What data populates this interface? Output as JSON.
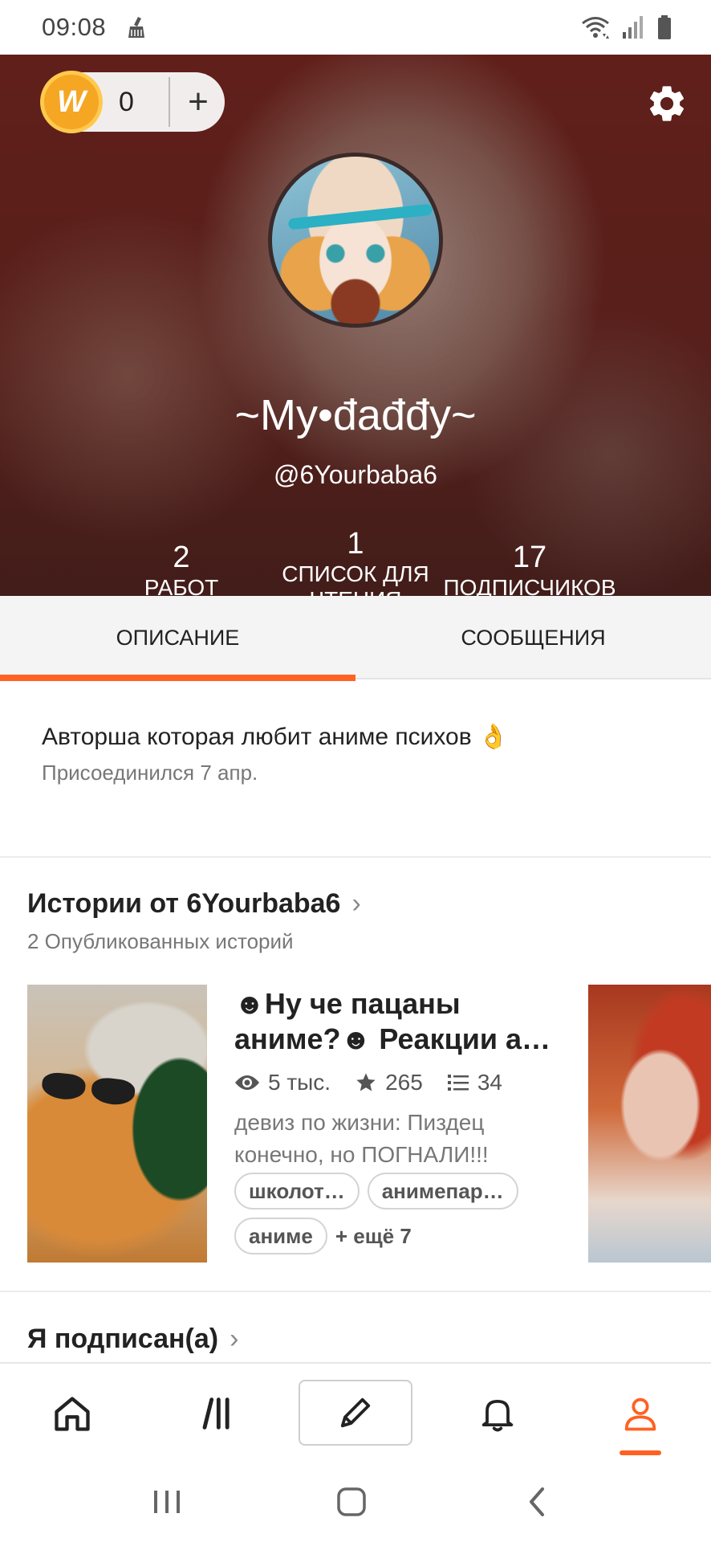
{
  "status_bar": {
    "time": "09:08",
    "left_icon": "cleaner-icon",
    "right_icons": [
      "wifi-icon",
      "signal-icon",
      "battery-icon"
    ]
  },
  "header": {
    "coins": {
      "count": "0",
      "add_label": "+"
    },
    "settings_icon": "gear-icon",
    "display_name": "~My•đađđy~",
    "username": "@6Yourbaba6",
    "stats": {
      "works": {
        "value": "2",
        "label": "РАБОТ"
      },
      "reading_lists": {
        "value": "1",
        "label_line1": "СПИСОК ДЛЯ",
        "label_line2": "ЧТЕНИЯ"
      },
      "followers": {
        "value": "17",
        "label": "ПОДПИСЧИКОВ"
      }
    }
  },
  "tabs": [
    {
      "label": "ОПИСАНИЕ",
      "active": true
    },
    {
      "label": "СООБЩЕНИЯ",
      "active": false
    }
  ],
  "about": {
    "text": "Авторша которая любит аниме психов 👌",
    "joined": "Присоединился 7 апр."
  },
  "stories": {
    "title": "Истории от 6Yourbaba6",
    "subtitle": "2 Опубликованных историй",
    "items": [
      {
        "title_line1": "☻Ну че пацаны",
        "title_line2": "аниме?☻ Реакции а…",
        "reads": "5 тыс.",
        "votes": "265",
        "parts": "34",
        "description": "девиз по жизни: Пиздец конечно, но ПОГНАЛИ!!!",
        "tags": [
          "школот…",
          "анимепар…",
          "аниме"
        ],
        "more_tags": "+ ещё 7"
      }
    ]
  },
  "following": {
    "title": "Я подписан(а)"
  },
  "bottom_nav": {
    "items": [
      "home-icon",
      "library-icon",
      "write-icon",
      "notifications-icon",
      "profile-icon"
    ],
    "active": "profile-icon",
    "accent_color": "#ff6122"
  },
  "system_nav": [
    "recent-apps-icon",
    "home-button-icon",
    "back-icon"
  ]
}
